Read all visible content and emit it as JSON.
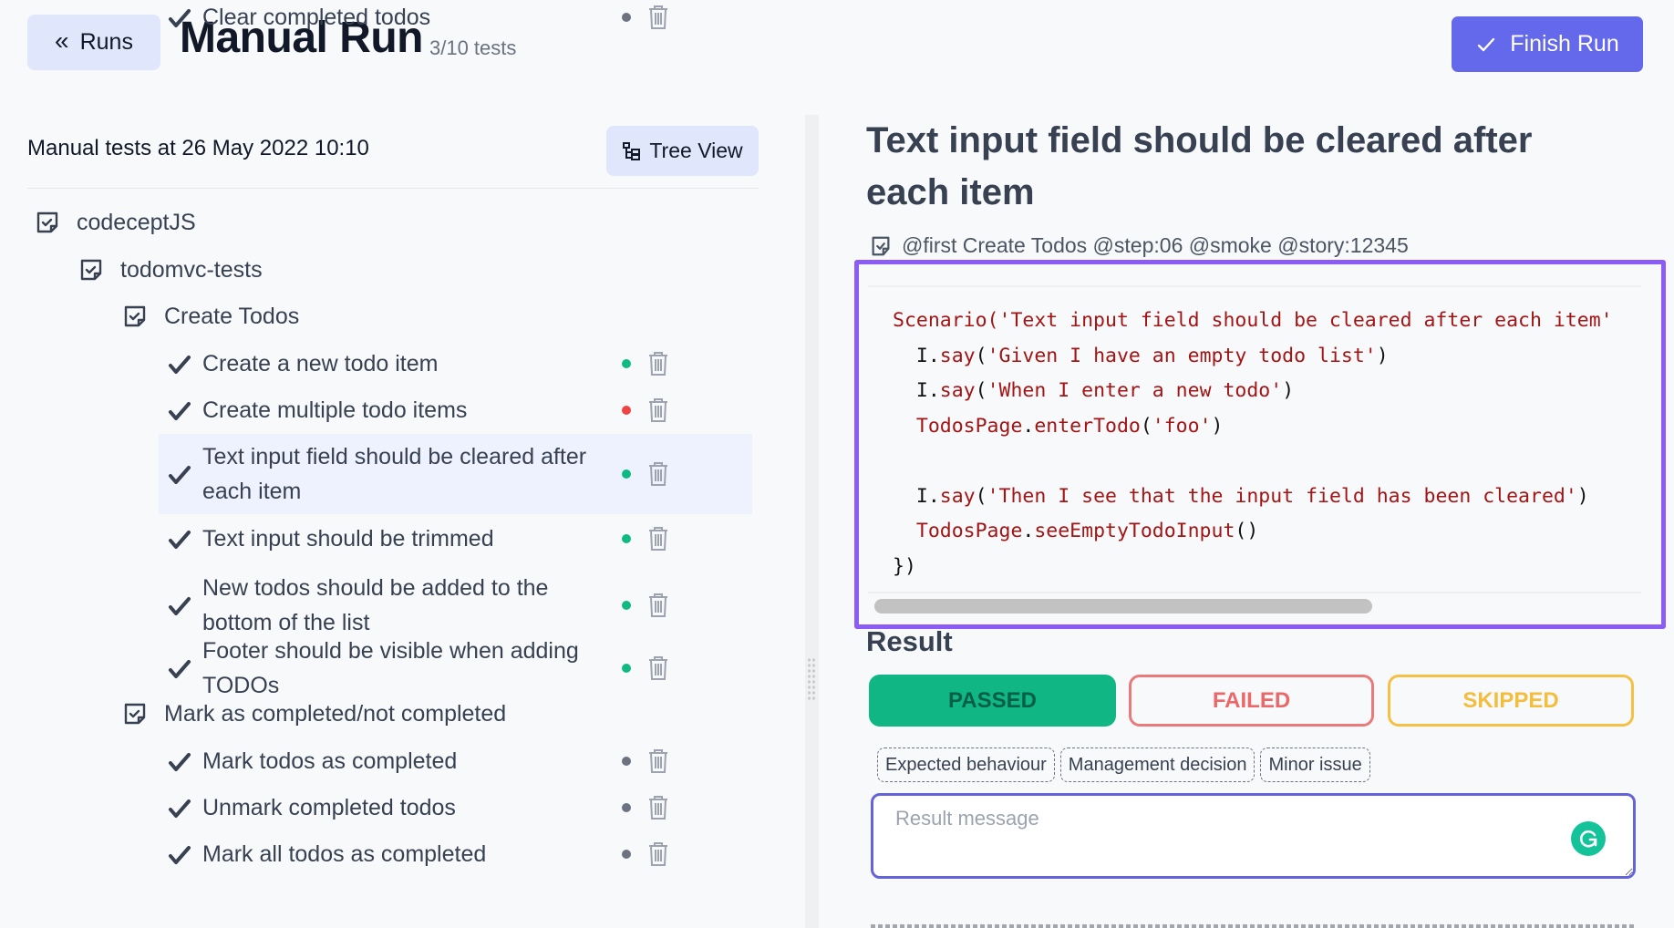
{
  "header": {
    "back_label": "Runs",
    "title": "Manual Run",
    "progress": "3/10 tests",
    "finish_label": "Finish Run"
  },
  "sidebar": {
    "run_title": "Manual tests at 26 May 2022 10:10",
    "tree_view_label": "Tree View",
    "tree": [
      {
        "type": "folder",
        "label": "codeceptJS",
        "level": 0
      },
      {
        "type": "folder",
        "label": "todomvc-tests",
        "level": 1
      },
      {
        "type": "folder",
        "label": "Create Todos",
        "level": 2
      },
      {
        "type": "test",
        "label": "Create a new todo item",
        "status": "passed",
        "selected": false
      },
      {
        "type": "test",
        "label": "Create multiple todo items",
        "status": "failed",
        "selected": false
      },
      {
        "type": "test",
        "label": "Text input field should be cleared after each item",
        "status": "passed",
        "selected": true
      },
      {
        "type": "test",
        "label": "Text input should be trimmed",
        "status": "passed",
        "selected": false
      },
      {
        "type": "test",
        "label": "New todos should be added to the bottom of the list",
        "status": "passed",
        "selected": false
      },
      {
        "type": "test",
        "label": "Footer should be visible when adding TODOs",
        "status": "passed",
        "selected": false
      },
      {
        "type": "folder",
        "label": "Mark as completed/not completed",
        "level": 2
      },
      {
        "type": "test",
        "label": "Mark todos as completed",
        "status": "pending",
        "selected": false
      },
      {
        "type": "test",
        "label": "Unmark completed todos",
        "status": "pending",
        "selected": false
      },
      {
        "type": "test",
        "label": "Mark all todos as completed",
        "status": "pending",
        "selected": false
      },
      {
        "type": "test",
        "label": "Clear completed todos",
        "status": "pending",
        "selected": false
      }
    ],
    "status_colors": {
      "passed": "#10b981",
      "failed": "#ef4444",
      "pending": "#6b7280"
    }
  },
  "detail": {
    "title": "Text input field should be cleared after each item",
    "tags": "@first Create Todos @step:06 @smoke @story:12345",
    "code_lines": [
      [
        {
          "t": "Scenario(",
          "c": "r"
        },
        {
          "t": "'Text input field should be cleared after each item'",
          "c": "s"
        }
      ],
      [
        {
          "t": "  I.",
          "c": ""
        },
        {
          "t": "say",
          "c": "r"
        },
        {
          "t": "(",
          "c": ""
        },
        {
          "t": "'Given I have an empty todo list'",
          "c": "s"
        },
        {
          "t": ")",
          "c": ""
        }
      ],
      [
        {
          "t": "  I.",
          "c": ""
        },
        {
          "t": "say",
          "c": "r"
        },
        {
          "t": "(",
          "c": ""
        },
        {
          "t": "'When I enter a new todo'",
          "c": "s"
        },
        {
          "t": ")",
          "c": ""
        }
      ],
      [
        {
          "t": "  TodosPage",
          "c": "r"
        },
        {
          "t": ".",
          "c": ""
        },
        {
          "t": "enterTodo",
          "c": "r"
        },
        {
          "t": "(",
          "c": ""
        },
        {
          "t": "'foo'",
          "c": "s"
        },
        {
          "t": ")",
          "c": ""
        }
      ],
      [
        {
          "t": "",
          "c": ""
        }
      ],
      [
        {
          "t": "  I.",
          "c": ""
        },
        {
          "t": "say",
          "c": "r"
        },
        {
          "t": "(",
          "c": ""
        },
        {
          "t": "'Then I see that the input field has been cleared'",
          "c": "s"
        },
        {
          "t": ")",
          "c": ""
        }
      ],
      [
        {
          "t": "  TodosPage",
          "c": "r"
        },
        {
          "t": ".",
          "c": ""
        },
        {
          "t": "seeEmptyTodoInput",
          "c": "r"
        },
        {
          "t": "()",
          "c": ""
        }
      ],
      [
        {
          "t": "})",
          "c": ""
        }
      ]
    ],
    "result_heading": "Result",
    "status_buttons": {
      "passed": "PASSED",
      "failed": "FAILED",
      "skipped": "SKIPPED"
    },
    "selected_status": "passed",
    "chips": [
      "Expected behaviour",
      "Management decision",
      "Minor issue"
    ],
    "message_placeholder": "Result message",
    "message_value": ""
  }
}
